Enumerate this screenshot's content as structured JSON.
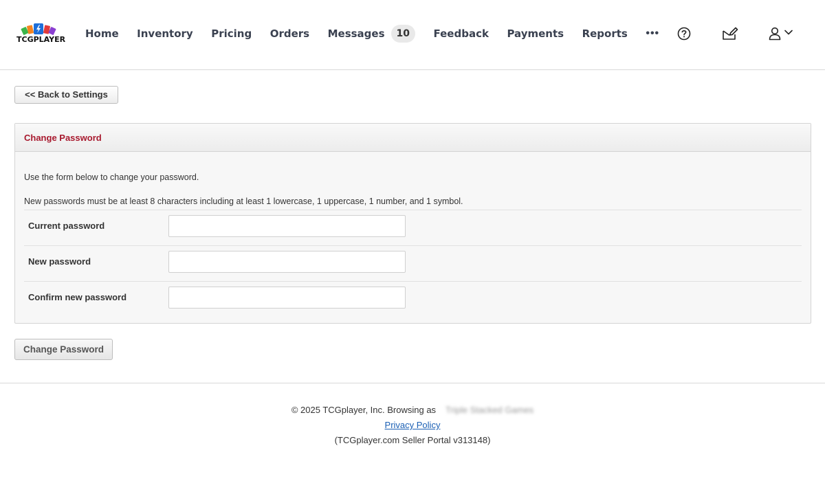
{
  "header": {
    "logo_text": "TCGPLAYER",
    "nav": [
      {
        "label": "Home"
      },
      {
        "label": "Inventory"
      },
      {
        "label": "Pricing"
      },
      {
        "label": "Orders"
      },
      {
        "label": "Messages",
        "badge": "10"
      },
      {
        "label": "Feedback"
      },
      {
        "label": "Payments"
      },
      {
        "label": "Reports"
      }
    ],
    "more_label": "•••",
    "icons": [
      "help-icon",
      "compose-icon",
      "user-icon",
      "chevron-down-icon"
    ]
  },
  "back_button": {
    "label": "<< Back to Settings"
  },
  "panel": {
    "title": "Change Password",
    "intro_1": "Use the form below to change your password.",
    "intro_2": "New passwords must be at least 8 characters including at least 1 lowercase, 1 uppercase, 1 number, and 1 symbol.",
    "fields": [
      {
        "label": "Current password",
        "value": ""
      },
      {
        "label": "New password",
        "value": ""
      },
      {
        "label": "Confirm new password",
        "value": ""
      }
    ]
  },
  "submit_button": {
    "label": "Change Password"
  },
  "footer": {
    "copyright": "© 2025 TCGplayer, Inc. Browsing as",
    "browsing_as": "Triple Stacked Games",
    "privacy_link": "Privacy Policy",
    "version": "(TCGplayer.com Seller Portal v313148)"
  },
  "colors": {
    "title_red": "#a8192e",
    "link_blue": "#1a5fb4",
    "logo_blue": "#1e6fd9",
    "logo_orange": "#f5841f",
    "logo_green": "#3bb54a",
    "logo_red": "#e23b3b",
    "logo_purple": "#8a3fd1"
  }
}
